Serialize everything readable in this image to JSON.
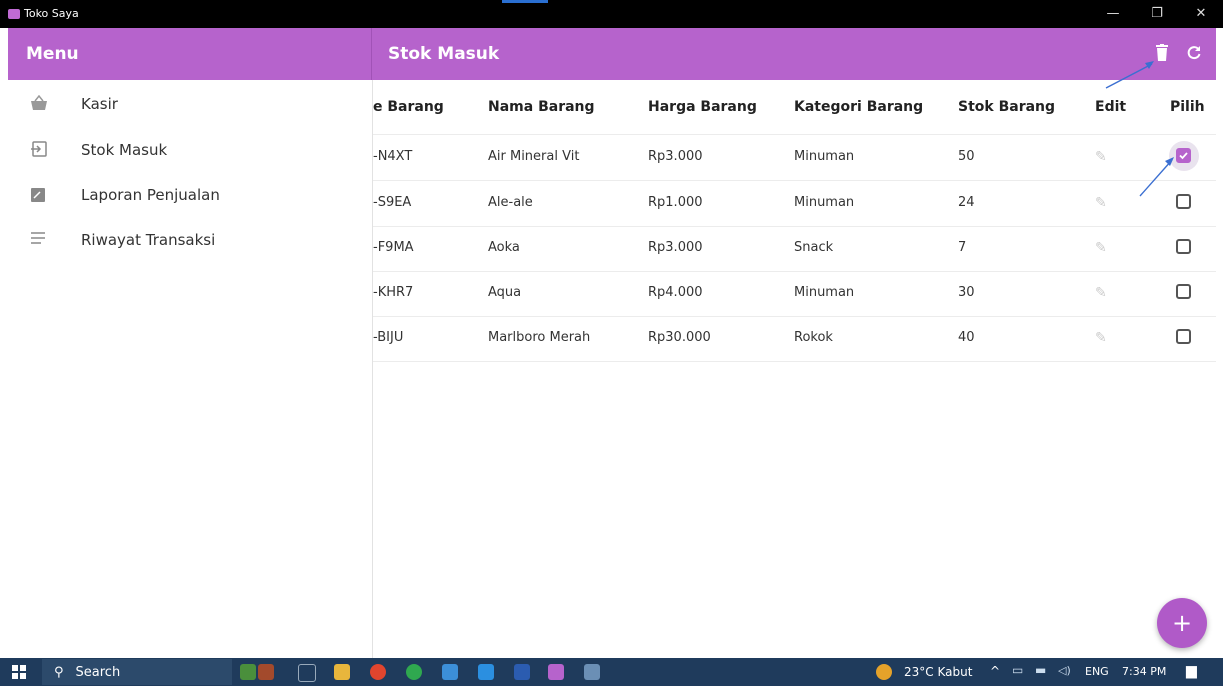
{
  "window": {
    "title": "Toko Saya",
    "minimize": "—",
    "restore": "❐",
    "close": "✕"
  },
  "appbar": {
    "menu_title": "Menu",
    "page_title": "Stok Masuk",
    "delete_icon": "trash-icon",
    "refresh_icon": "refresh-icon"
  },
  "sidebar": {
    "items": [
      {
        "label": "Kasir",
        "icon": "basket-icon"
      },
      {
        "label": "Stok Masuk",
        "icon": "input-icon"
      },
      {
        "label": "Laporan Penjualan",
        "icon": "report-icon"
      },
      {
        "label": "Riwayat Transaksi",
        "icon": "list-icon"
      }
    ]
  },
  "table": {
    "headers": [
      "e Barang",
      "Nama Barang",
      "Harga Barang",
      "Kategori Barang",
      "Stok Barang",
      "Edit",
      "Pilih"
    ],
    "rows": [
      {
        "kode": "-N4XT",
        "nama": "Air Mineral Vit",
        "harga": "Rp3.000",
        "kategori": "Minuman",
        "stok": "50",
        "checked": true
      },
      {
        "kode": "-S9EA",
        "nama": "Ale-ale",
        "harga": "Rp1.000",
        "kategori": "Minuman",
        "stok": "24",
        "checked": false
      },
      {
        "kode": "-F9MA",
        "nama": "Aoka",
        "harga": "Rp3.000",
        "kategori": "Snack",
        "stok": "7",
        "checked": false
      },
      {
        "kode": "-KHR7",
        "nama": "Aqua",
        "harga": "Rp4.000",
        "kategori": "Minuman",
        "stok": "30",
        "checked": false
      },
      {
        "kode": "-BIJU",
        "nama": "Marlboro Merah",
        "harga": "Rp30.000",
        "kategori": "Rokok",
        "stok": "40",
        "checked": false
      }
    ]
  },
  "fab": {
    "label": "+"
  },
  "taskbar": {
    "search_placeholder": "Search",
    "weather": "23°C Kabut",
    "lang": "ENG",
    "time": "7:34 PM"
  },
  "colors": {
    "accent": "#b663cc",
    "taskbar": "#1f3b5c"
  }
}
